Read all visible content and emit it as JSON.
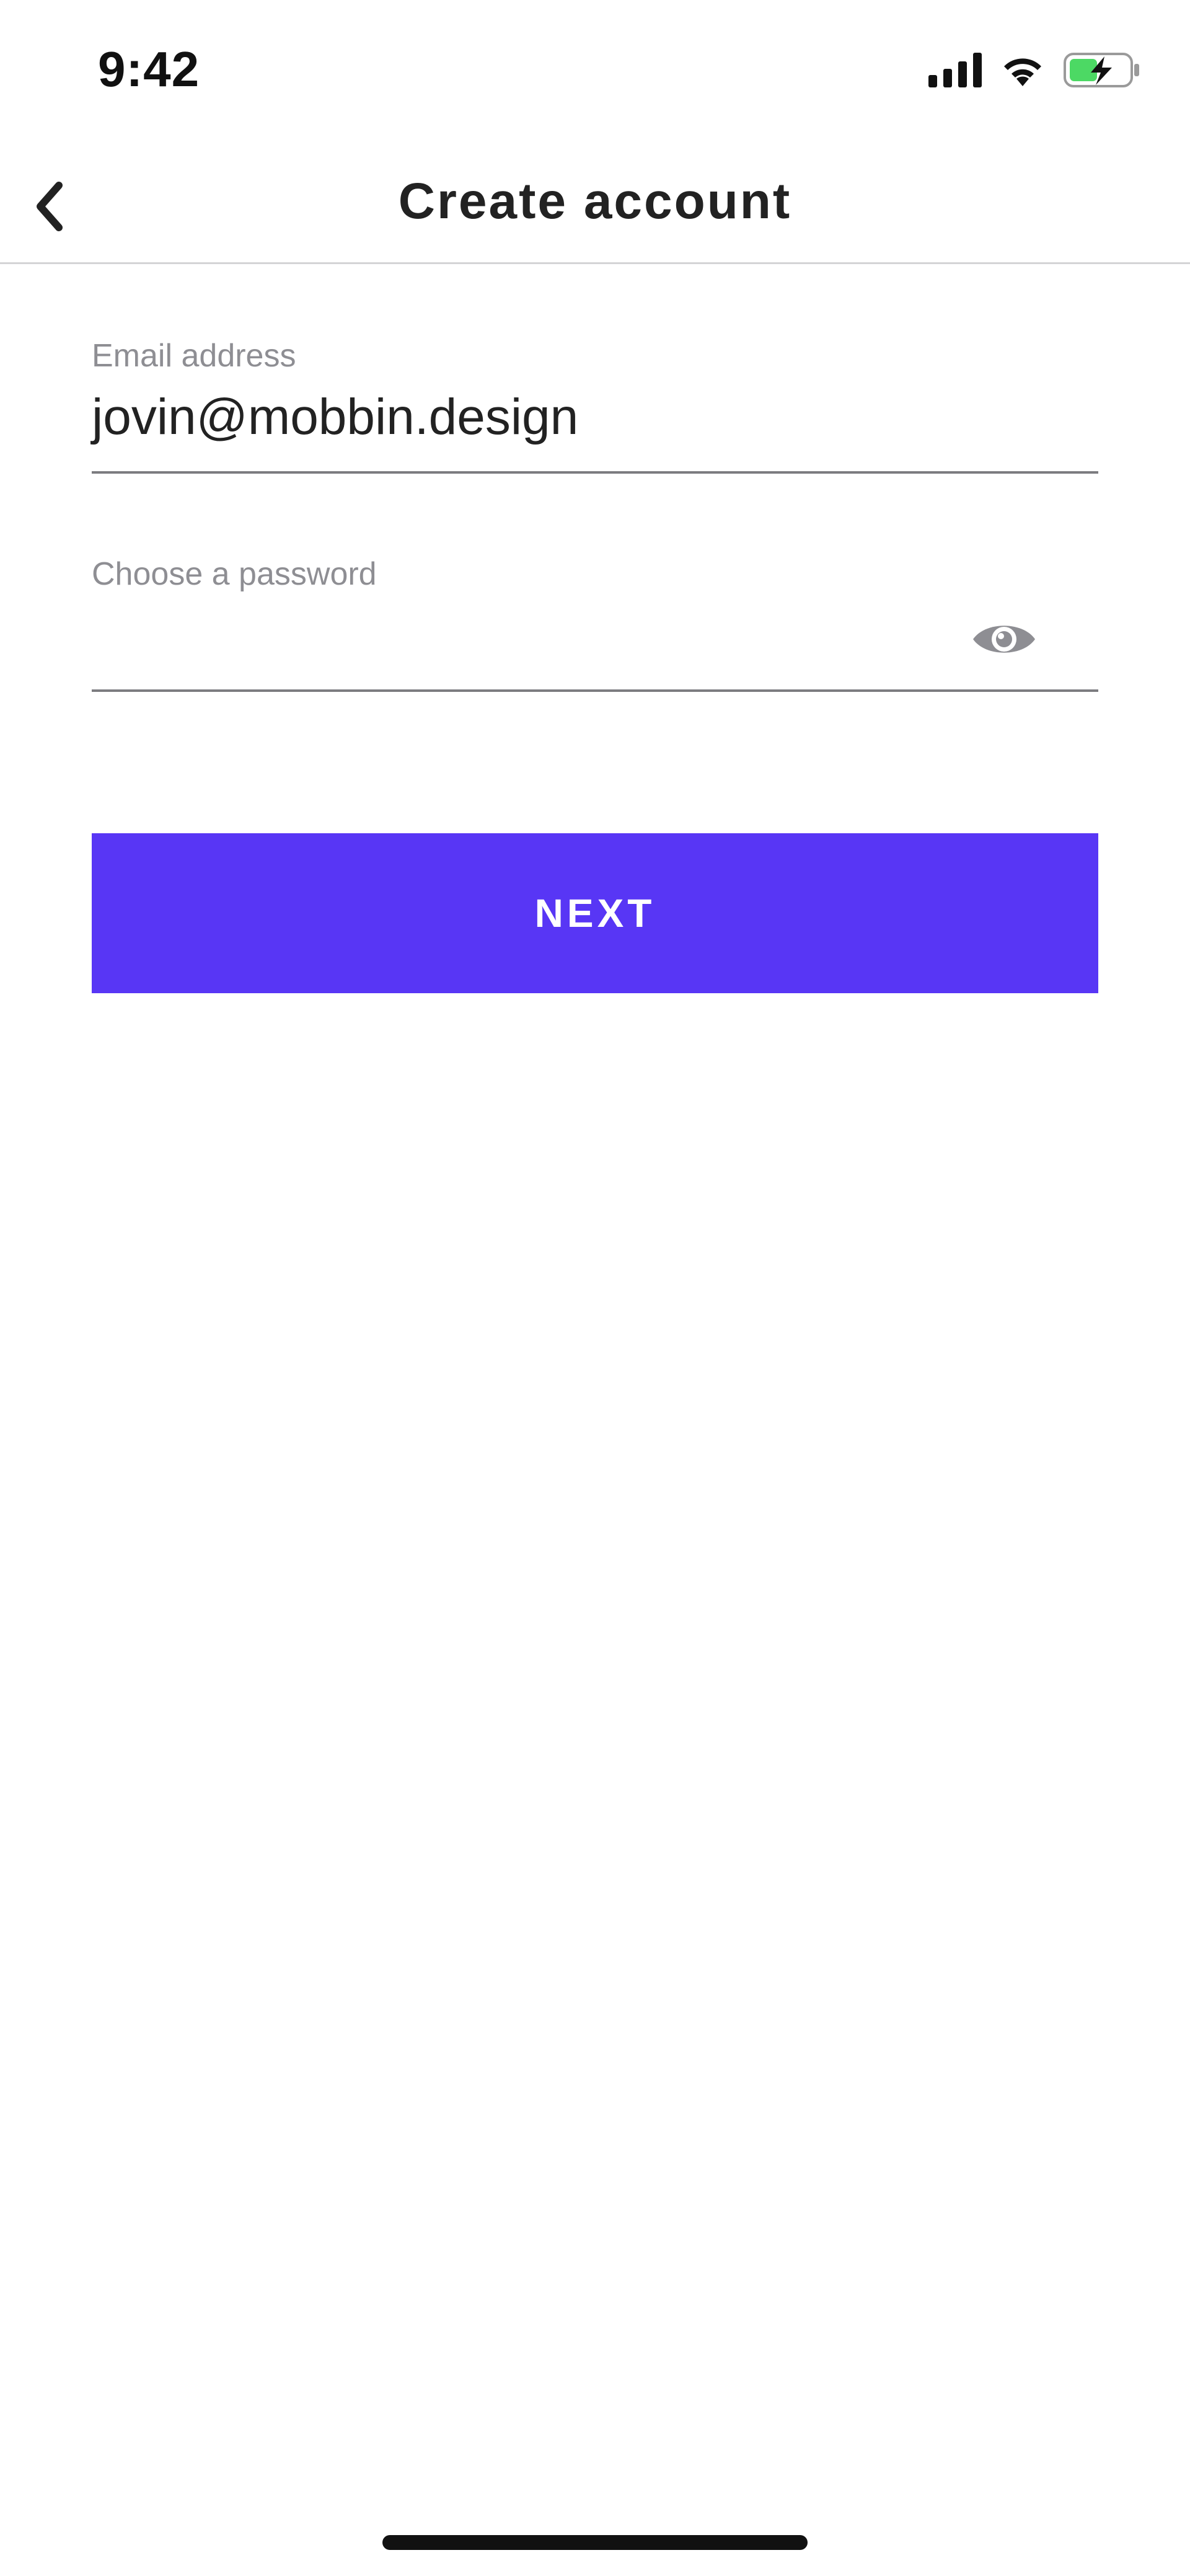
{
  "status_bar": {
    "time": "9:42",
    "icons": [
      "cellular-signal-icon",
      "wifi-icon",
      "battery-charging-icon"
    ],
    "battery_color": "#4cd964"
  },
  "nav": {
    "title": "Create account",
    "back_icon": "chevron-left-icon"
  },
  "form": {
    "email": {
      "label": "Email address",
      "value": "jovin@mobbin.design"
    },
    "password": {
      "label": "Choose a password",
      "value": "",
      "toggle_icon": "eye-icon"
    }
  },
  "actions": {
    "next_label": "NEXT"
  },
  "colors": {
    "accent": "#5836f5",
    "label_gray": "#8e8e93",
    "text_dark": "#222222"
  }
}
